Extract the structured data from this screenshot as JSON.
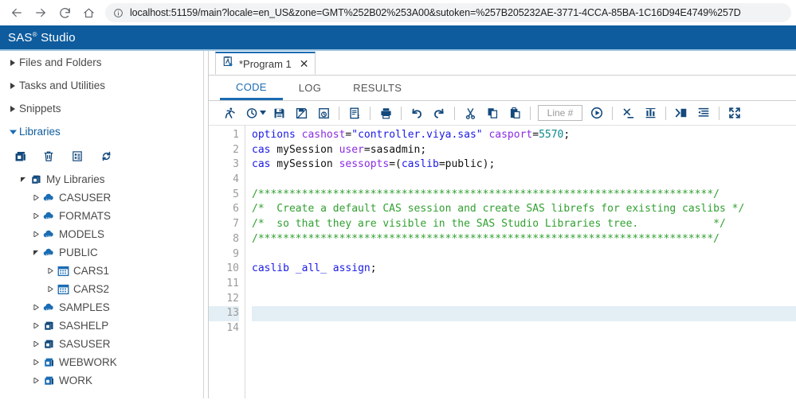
{
  "browser": {
    "back_icon": "back-arrow-icon",
    "forward_icon": "forward-arrow-icon",
    "reload_icon": "reload-icon",
    "home_icon": "home-icon",
    "info_icon": "info-circle-icon",
    "url": "localhost:51159/main?locale=en_US&zone=GMT%252B02%253A00&sutoken=%257B205232AE-3771-4CCA-85BA-1C16D94E4749%257D"
  },
  "banner": {
    "product": "SAS",
    "trademark": "®",
    "suffix": " Studio",
    "background": "#0e5c9e"
  },
  "sidebar": {
    "accordions": [
      {
        "label": "Files and Folders",
        "expanded": false
      },
      {
        "label": "Tasks and Utilities",
        "expanded": false
      },
      {
        "label": "Snippets",
        "expanded": false
      },
      {
        "label": "Libraries",
        "expanded": true
      }
    ],
    "toolbar": [
      {
        "name": "new-library-icon"
      },
      {
        "name": "delete-library-icon"
      },
      {
        "name": "library-properties-icon"
      },
      {
        "name": "refresh-icon"
      }
    ],
    "tree": [
      {
        "label": "My Libraries",
        "level": 0,
        "icon": "libraries-root-icon",
        "expanded": true
      },
      {
        "label": "CASUSER",
        "level": 1,
        "icon": "cas-library-icon",
        "expanded": false
      },
      {
        "label": "FORMATS",
        "level": 1,
        "icon": "cas-library-icon",
        "expanded": false
      },
      {
        "label": "MODELS",
        "level": 1,
        "icon": "cas-library-icon",
        "expanded": false
      },
      {
        "label": "PUBLIC",
        "level": 1,
        "icon": "cas-library-icon",
        "expanded": true
      },
      {
        "label": "CARS1",
        "level": 2,
        "icon": "table-icon",
        "expanded": false
      },
      {
        "label": "CARS2",
        "level": 2,
        "icon": "table-icon",
        "expanded": false
      },
      {
        "label": "SAMPLES",
        "level": 1,
        "icon": "cas-library-icon",
        "expanded": false
      },
      {
        "label": "SASHELP",
        "level": 1,
        "icon": "sas-library-icon",
        "expanded": false
      },
      {
        "label": "SASUSER",
        "level": 1,
        "icon": "sas-library-icon",
        "expanded": false
      },
      {
        "label": "WEBWORK",
        "level": 1,
        "icon": "work-library-icon",
        "expanded": false
      },
      {
        "label": "WORK",
        "level": 1,
        "icon": "work-library-icon",
        "expanded": false
      }
    ]
  },
  "workspace": {
    "tab": {
      "icon": "sas-program-icon",
      "title": "*Program 1",
      "close": "✕"
    },
    "subtabs": [
      {
        "label": "CODE",
        "active": true
      },
      {
        "label": "LOG",
        "active": false
      },
      {
        "label": "RESULTS",
        "active": false
      }
    ],
    "toolbar": {
      "buttons": [
        {
          "name": "run-icon"
        },
        {
          "name": "run-history-icon"
        },
        {
          "name": "save-icon"
        },
        {
          "name": "save-as-icon"
        },
        {
          "name": "open-icon"
        },
        {
          "name": "program-properties-icon"
        },
        {
          "name": "print-icon"
        },
        {
          "name": "undo-icon"
        },
        {
          "name": "redo-icon"
        },
        {
          "name": "cut-icon"
        },
        {
          "name": "copy-icon"
        },
        {
          "name": "paste-icon"
        },
        {
          "name": "go-to-line-icon"
        },
        {
          "name": "clear-all-icon"
        },
        {
          "name": "compare-icon"
        },
        {
          "name": "macro-icon"
        },
        {
          "name": "format-code-icon"
        },
        {
          "name": "maximize-view-icon"
        }
      ],
      "line_number_placeholder": "Line #",
      "line_number_value": ""
    },
    "editor": {
      "current_line": 13,
      "total_lines": 14,
      "line_numbers": [
        1,
        2,
        3,
        4,
        5,
        6,
        7,
        8,
        9,
        10,
        11,
        12,
        13,
        14
      ],
      "lines": [
        [
          {
            "t": "options",
            "c": "k"
          },
          {
            "t": " ",
            "c": "t"
          },
          {
            "t": "cashost",
            "c": "o"
          },
          {
            "t": "=",
            "c": "t"
          },
          {
            "t": "\"controller.viya.sas\"",
            "c": "s"
          },
          {
            "t": " ",
            "c": "t"
          },
          {
            "t": "casport",
            "c": "o"
          },
          {
            "t": "=",
            "c": "t"
          },
          {
            "t": "5570",
            "c": "n"
          },
          {
            "t": ";",
            "c": "t"
          }
        ],
        [
          {
            "t": "cas",
            "c": "k"
          },
          {
            "t": " mySession ",
            "c": "t"
          },
          {
            "t": "user",
            "c": "o"
          },
          {
            "t": "=sasadmin;",
            "c": "t"
          }
        ],
        [
          {
            "t": "cas",
            "c": "k"
          },
          {
            "t": " mySession ",
            "c": "t"
          },
          {
            "t": "sessopts",
            "c": "o"
          },
          {
            "t": "=(",
            "c": "t"
          },
          {
            "t": "caslib",
            "c": "k"
          },
          {
            "t": "=public);",
            "c": "t"
          }
        ],
        [],
        [
          {
            "t": "/*************************************************************************/",
            "c": "c"
          }
        ],
        [
          {
            "t": "/*  Create a default CAS session and create SAS librefs for existing caslibs */",
            "c": "c"
          }
        ],
        [
          {
            "t": "/*  so that they are visible in the SAS Studio Libraries tree.            */",
            "c": "c"
          }
        ],
        [
          {
            "t": "/*************************************************************************/",
            "c": "c"
          }
        ],
        [],
        [
          {
            "t": "caslib",
            "c": "k"
          },
          {
            "t": " ",
            "c": "t"
          },
          {
            "t": "_all_",
            "c": "k"
          },
          {
            "t": " ",
            "c": "t"
          },
          {
            "t": "assign",
            "c": "k"
          },
          {
            "t": ";",
            "c": "t"
          }
        ],
        [],
        [],
        [],
        []
      ]
    }
  }
}
